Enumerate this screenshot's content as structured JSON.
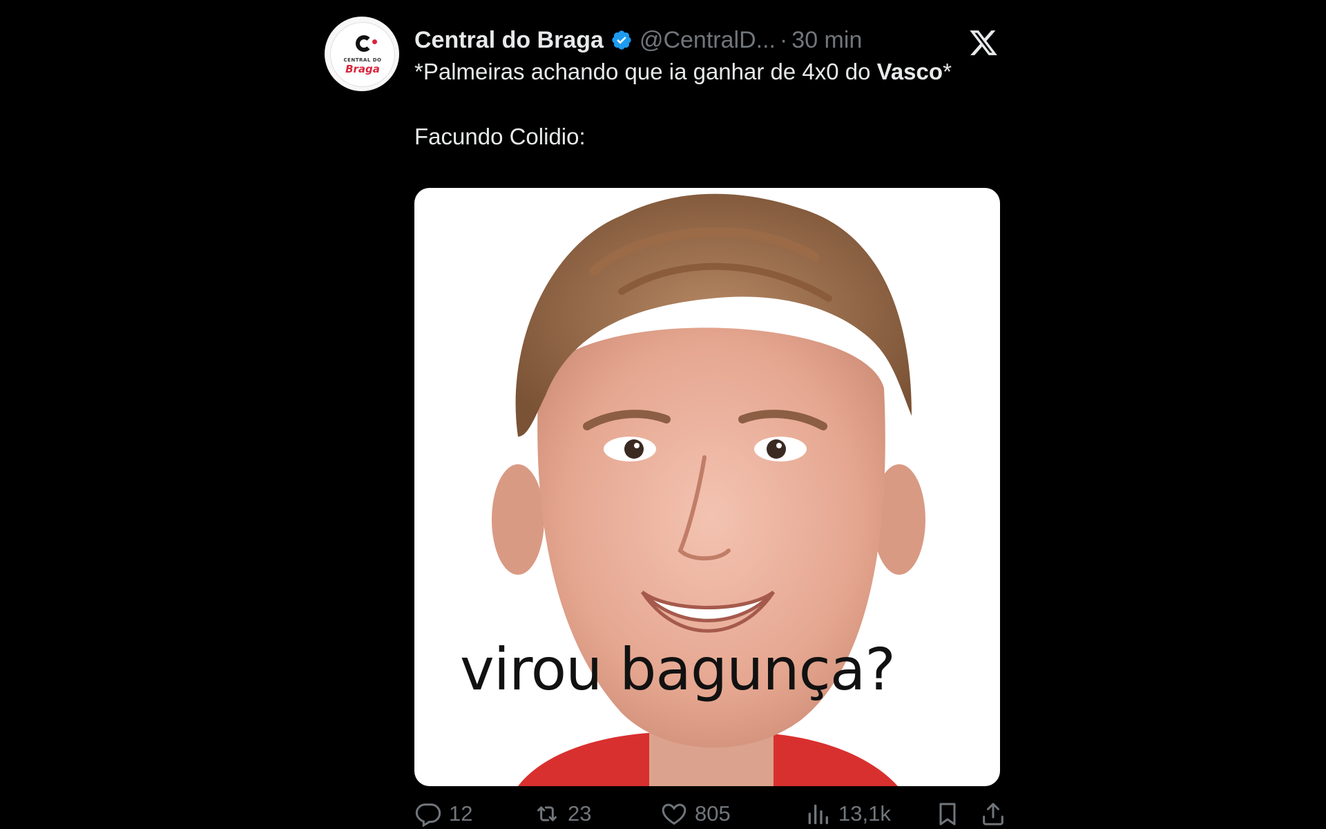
{
  "tweet": {
    "author": {
      "name": "Central do Braga",
      "handle": "@CentralD...",
      "verified": true,
      "avatar_small": "CENTRAL DO",
      "avatar_brand": "Braga"
    },
    "separator": "·",
    "time": "30 min",
    "text": {
      "line1_pre": "*Palmeiras achando que ia ganhar de 4x0 do ",
      "line1_bold": "Vasco",
      "line1_post": "*",
      "line2": "Facundo Colidio:"
    },
    "media": {
      "caption": "virou bagunça?"
    },
    "metrics": {
      "replies": "12",
      "retweets": "23",
      "likes": "805",
      "views": "13,1k"
    }
  },
  "colors": {
    "background": "#000000",
    "text": "#e7e9ea",
    "muted": "#71767b",
    "verified": "#1d9bf0",
    "brand_red": "#d7263d"
  },
  "icons": [
    "verified-badge-icon",
    "x-logo-icon",
    "reply-icon",
    "retweet-icon",
    "like-icon",
    "views-icon",
    "bookmark-icon",
    "share-icon"
  ]
}
